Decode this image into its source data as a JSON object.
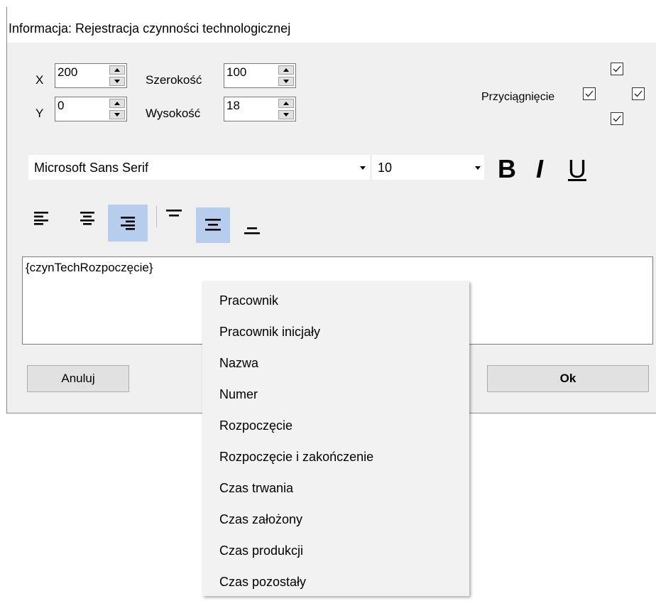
{
  "dialog": {
    "title": "Informacja: Rejestracja czynności technologicznej",
    "x_label": "X",
    "x_value": "200",
    "y_label": "Y",
    "y_value": "0",
    "width_label": "Szerokość",
    "width_value": "100",
    "height_label": "Wysokość",
    "height_value": "18",
    "snap_label": "Przyciągnięcie",
    "snap_checks": {
      "top": true,
      "left": true,
      "right": true,
      "bottom": true
    },
    "font_name": "Microsoft Sans Serif",
    "font_size": "10",
    "bold_label": "B",
    "italic_label": "I",
    "underline_label": "U",
    "align": {
      "horizontal": "right",
      "vertical": "middle"
    },
    "text_value": "{czynTechRozpoczęcie}",
    "cancel_label": "Anuluj",
    "ok_label": "Ok"
  },
  "context_menu": {
    "items": [
      "Pracownik",
      "Pracownik inicjały",
      "Nazwa",
      "Numer",
      "Rozpoczęcie",
      "Rozpoczęcie i zakończenie",
      "Czas trwania",
      "Czas założony",
      "Czas produkcji",
      "Czas pozostały"
    ]
  },
  "colors": {
    "dialog_bg": "#f0f0f0",
    "active_align_bg": "#b7cdee",
    "menu_bg": "#f2f2f2",
    "button_bg": "#e1e1e1"
  }
}
